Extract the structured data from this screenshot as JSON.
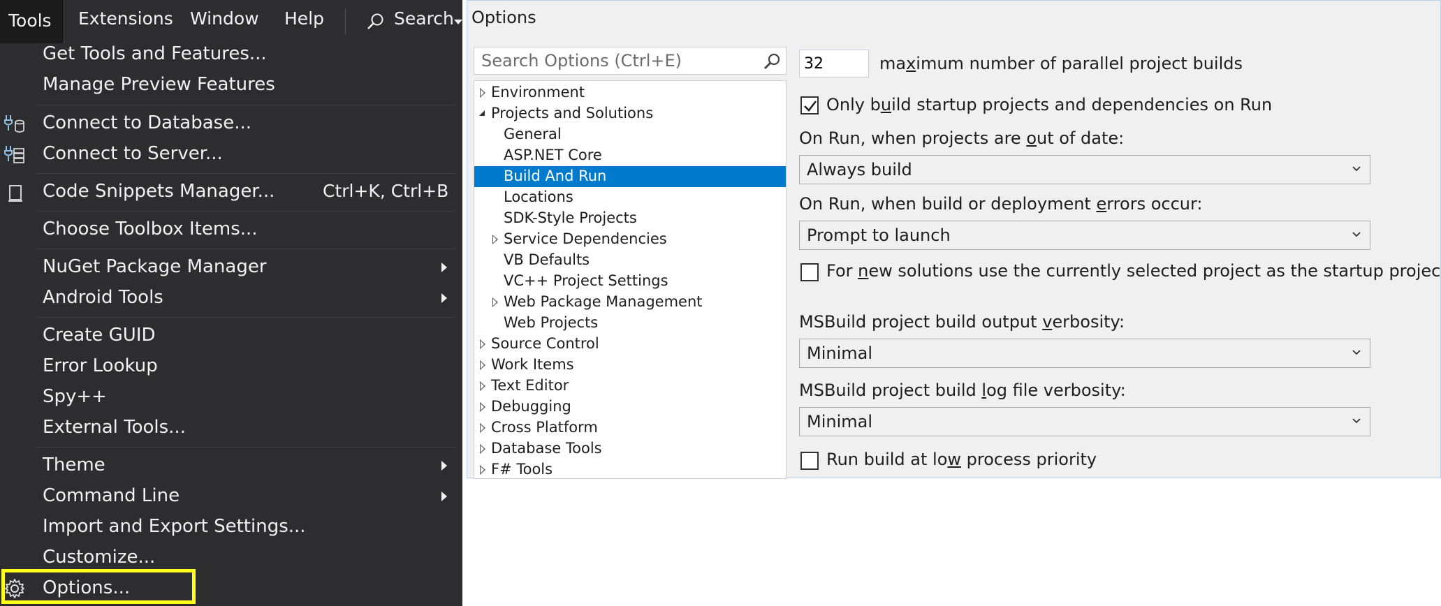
{
  "menubar": {
    "items": [
      "Tools",
      "Extensions",
      "Window",
      "Help"
    ],
    "search_label": "Search"
  },
  "tools_menu": {
    "get_tools": "Get Tools and Features...",
    "manage_preview": "Manage Preview Features",
    "connect_db": "Connect to Database...",
    "connect_server": "Connect to Server...",
    "code_snippets": "Code Snippets Manager...",
    "code_snippets_shortcut": "Ctrl+K, Ctrl+B",
    "choose_toolbox": "Choose Toolbox Items...",
    "nuget": "NuGet Package Manager",
    "android": "Android Tools",
    "create_guid": "Create GUID",
    "error_lookup": "Error Lookup",
    "spy": "Spy++",
    "external_tools": "External Tools...",
    "theme": "Theme",
    "command_line": "Command Line",
    "import_export": "Import and Export Settings...",
    "customize": "Customize...",
    "options": "Options..."
  },
  "dialog": {
    "title": "Options",
    "search_placeholder": "Search Options (Ctrl+E)",
    "tree": {
      "environment": "Environment",
      "projects_solutions": "Projects and Solutions",
      "general": "General",
      "aspnet_core": "ASP.NET Core",
      "build_and_run": "Build And Run",
      "locations": "Locations",
      "sdk_style": "SDK-Style Projects",
      "service_deps": "Service Dependencies",
      "vb_defaults": "VB Defaults",
      "vcpp_settings": "VC++ Project Settings",
      "web_package": "Web Package Management",
      "web_projects": "Web Projects",
      "source_control": "Source Control",
      "work_items": "Work Items",
      "text_editor": "Text Editor",
      "debugging": "Debugging",
      "cross_platform": "Cross Platform",
      "database_tools": "Database Tools",
      "fsharp_tools": "F# Tools"
    },
    "settings": {
      "parallel_builds_value": "32",
      "parallel_builds_label_pre": "ma",
      "parallel_builds_label_ul": "x",
      "parallel_builds_label_post": "imum number of parallel project builds",
      "only_build_startup_pre": "Only b",
      "only_build_startup_ul": "u",
      "only_build_startup_post": "ild startup projects and dependencies on Run",
      "only_build_startup_checked": true,
      "out_of_date_pre": "On Run, when projects are ",
      "out_of_date_ul": "o",
      "out_of_date_post": "ut of date:",
      "out_of_date_value": "Always build",
      "errors_pre": "On Run, when build or deployment ",
      "errors_ul": "e",
      "errors_post": "rrors occur:",
      "errors_value": "Prompt to launch",
      "new_solutions_pre": "For ",
      "new_solutions_ul": "n",
      "new_solutions_post": "ew solutions use the currently selected project as the startup project",
      "new_solutions_checked": false,
      "output_verbosity_pre": "MSBuild project build output ",
      "output_verbosity_ul": "v",
      "output_verbosity_post": "erbosity:",
      "output_verbosity_value": "Minimal",
      "log_verbosity_pre": "MSBuild project build ",
      "log_verbosity_ul": "l",
      "log_verbosity_post": "og file verbosity:",
      "log_verbosity_value": "Minimal",
      "low_priority_pre": "Run build at lo",
      "low_priority_ul": "w",
      "low_priority_post": " process priority",
      "low_priority_checked": false
    }
  },
  "colors": {
    "menu_bg": "#2d2d30",
    "highlight": "#ffff1a",
    "selection": "#007acc"
  }
}
